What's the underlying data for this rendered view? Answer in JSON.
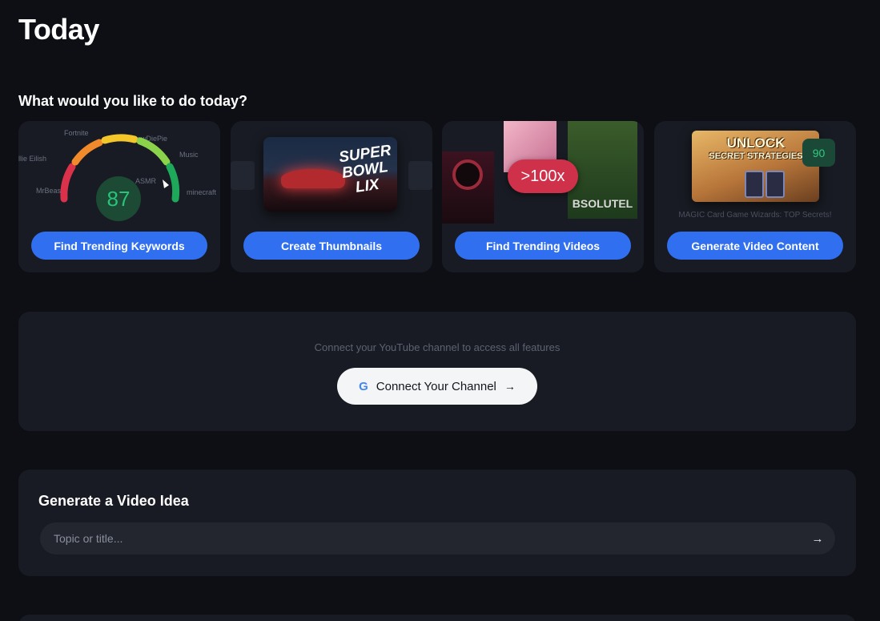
{
  "page_title": "Today",
  "section_heading": "What would you like to do today?",
  "cards": [
    {
      "button": "Find Trending Keywords",
      "score": "87",
      "words": [
        "Fortnite",
        "PewDiePie",
        "Billie Eilish",
        "Music",
        "ASMR",
        "MrBeast",
        "minecraft"
      ]
    },
    {
      "button": "Create Thumbnails",
      "thumb_text": "SUPER BOWL LIX"
    },
    {
      "button": "Find Trending Videos",
      "multiplier": ">100x",
      "thumb_text": "BSOLUTEL"
    },
    {
      "button": "Generate Video Content",
      "thumb_line1": "UNLOCK",
      "thumb_line2": "SECRET STRATEGIES",
      "score": "90",
      "caption": "MAGIC Card Game Wizards: TOP Secrets!"
    }
  ],
  "connect": {
    "note": "Connect your YouTube channel to access all features",
    "button": "Connect Your Channel",
    "google_icon": "G",
    "arrow_icon": "→"
  },
  "idea": {
    "title": "Generate a Video Idea",
    "placeholder": "Topic or title...",
    "submit_icon": "→"
  },
  "colors": {
    "background": "#0d0f14",
    "panel": "#181b23",
    "accent": "#2f6ff0",
    "score_green": "#27c47a",
    "multiplier_red": "#d0314a"
  }
}
